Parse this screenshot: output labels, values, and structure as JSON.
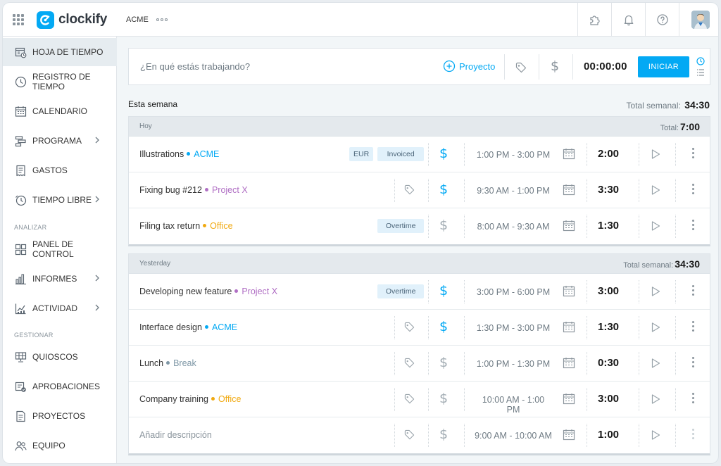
{
  "topbar": {
    "app_name": "clockify",
    "workspace": "ACME",
    "icons": [
      "grid-icon",
      "puzzle-icon",
      "bell-icon",
      "help-icon",
      "avatar"
    ]
  },
  "sidebar": {
    "items": [
      {
        "label": "HOJA DE TIEMPO",
        "icon": "timesheet-icon",
        "active": true
      },
      {
        "label": "REGISTRO DE TIEMPO",
        "icon": "clock-icon"
      },
      {
        "label": "CALENDARIO",
        "icon": "calendar-icon"
      },
      {
        "label": "PROGRAMA",
        "icon": "schedule-icon",
        "chevron": true
      },
      {
        "label": "GASTOS",
        "icon": "receipt-icon"
      },
      {
        "label": "TIEMPO LIBRE",
        "icon": "time-off-icon",
        "chevron": true
      }
    ],
    "section_analyze": "ANALIZAR",
    "analyze_items": [
      {
        "label": "PANEL DE CONTROL",
        "icon": "dashboard-icon"
      },
      {
        "label": "INFORMES",
        "icon": "reports-icon",
        "chevron": true
      },
      {
        "label": "ACTIVIDAD",
        "icon": "activity-icon",
        "chevron": true
      }
    ],
    "section_manage": "GESTIONAR",
    "manage_items": [
      {
        "label": "QUIOSCOS",
        "icon": "kiosk-icon"
      },
      {
        "label": "APROBACIONES",
        "icon": "approvals-icon"
      },
      {
        "label": "PROYECTOS",
        "icon": "projects-icon"
      },
      {
        "label": "EQUIPO",
        "icon": "team-icon"
      }
    ]
  },
  "tracker": {
    "placeholder": "¿En qué estás trabajando?",
    "project_label": "Proyecto",
    "timer": "00:00:00",
    "start_label": "INICIAR"
  },
  "week": {
    "label": "Esta semana",
    "total_label": "Total semanal:",
    "total": "34:30"
  },
  "colors": {
    "accent": "#03a9f4",
    "acme": "#03a9f4",
    "project_x": "#b06fc4",
    "office": "#f0a910",
    "break": "#7e97a6"
  },
  "groups": [
    {
      "label": "Hoy",
      "total_label": "Total:",
      "total": "7:00",
      "entries": [
        {
          "desc": "Illustrations",
          "project": "ACME",
          "color": "#03a9f4",
          "tags": [
            "EUR",
            "Invoiced"
          ],
          "billable": true,
          "range": "1:00 PM - 3:00 PM",
          "duration": "2:00"
        },
        {
          "desc": "Fixing bug #212",
          "project": "Project X",
          "color": "#b06fc4",
          "tags": [],
          "billable": true,
          "range": "9:30 AM - 1:00 PM",
          "duration": "3:30"
        },
        {
          "desc": "Filing tax return",
          "project": "Office",
          "color": "#f0a910",
          "tags": [
            "Overtime"
          ],
          "billable": false,
          "range": "8:00 AM - 9:30 AM",
          "duration": "1:30"
        }
      ]
    },
    {
      "label": "Yesterday",
      "total_label": "Total semanal:",
      "total": "34:30",
      "entries": [
        {
          "desc": "Developing new feature",
          "project": "Project X",
          "color": "#b06fc4",
          "tags": [
            "Overtime"
          ],
          "billable": true,
          "range": "3:00 PM - 6:00 PM",
          "duration": "3:00"
        },
        {
          "desc": "Interface design",
          "project": "ACME",
          "color": "#03a9f4",
          "tags": [],
          "billable": true,
          "range": "1:30 PM - 3:00 PM",
          "duration": "1:30"
        },
        {
          "desc": "Lunch",
          "project": "Break",
          "color": "#7e97a6",
          "tags": [],
          "billable": false,
          "range": "1:00 PM - 1:30 PM",
          "duration": "0:30"
        },
        {
          "desc": "Company training",
          "project": "Office",
          "color": "#f0a910",
          "tags": [],
          "billable": false,
          "range": "10:00 AM - 1:00 PM",
          "duration": "3:00"
        },
        {
          "desc": "Añadir descripción",
          "placeholder": true,
          "project": "",
          "color": "",
          "tags": [],
          "billable": false,
          "range": "9:00 AM - 10:00 AM",
          "duration": "1:00"
        }
      ]
    }
  ]
}
